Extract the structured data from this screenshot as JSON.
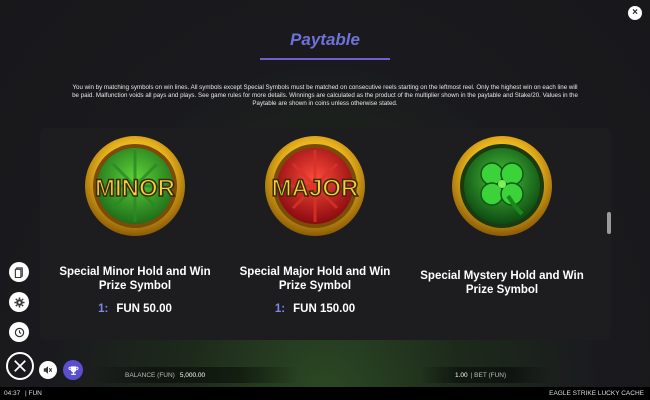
{
  "close_label": "×",
  "title": "Paytable",
  "intro": "You win by matching symbols on win lines. All symbols except Special Symbols must be matched on consecutive reels starting on the leftmost reel. Only the highest win on each line will be paid. Malfunction voids all pays and plays. See game rules for more details. Winnings are calculated as the product of the multiplier shown in the paytable and Stake/20. Values in the Paytable are shown in coins unless otherwise stated.",
  "symbols": [
    {
      "icon": "minor-coin-icon",
      "coin_text": "MINOR",
      "label": "Special Minor Hold and Win Prize Symbol",
      "multiplier": "1:",
      "prize": "FUN 50.00",
      "color": "#2f9a2a"
    },
    {
      "icon": "major-coin-icon",
      "coin_text": "MAJOR",
      "label": "Special Major Hold and Win Prize Symbol",
      "multiplier": "1:",
      "prize": "FUN 150.00",
      "color": "#c4161c"
    },
    {
      "icon": "clover-coin-icon",
      "label": "Special Mystery Hold and Win Prize Symbol",
      "color": "#1f8a2a"
    }
  ],
  "sidebar": [
    {
      "icon": "document-icon"
    },
    {
      "icon": "gear-icon"
    },
    {
      "icon": "history-icon"
    }
  ],
  "balance": {
    "label": "BALANCE (FUN)",
    "value": "5,000.00"
  },
  "bet": {
    "value": "1.00",
    "label": "| BET (FUN)"
  },
  "status": {
    "time": "04:37",
    "mode": "| FUN",
    "game": "EAGLE STRIKE LUCKY CACHE"
  },
  "colors": {
    "accent": "#6e72d6",
    "gold": "#e8b21c"
  }
}
